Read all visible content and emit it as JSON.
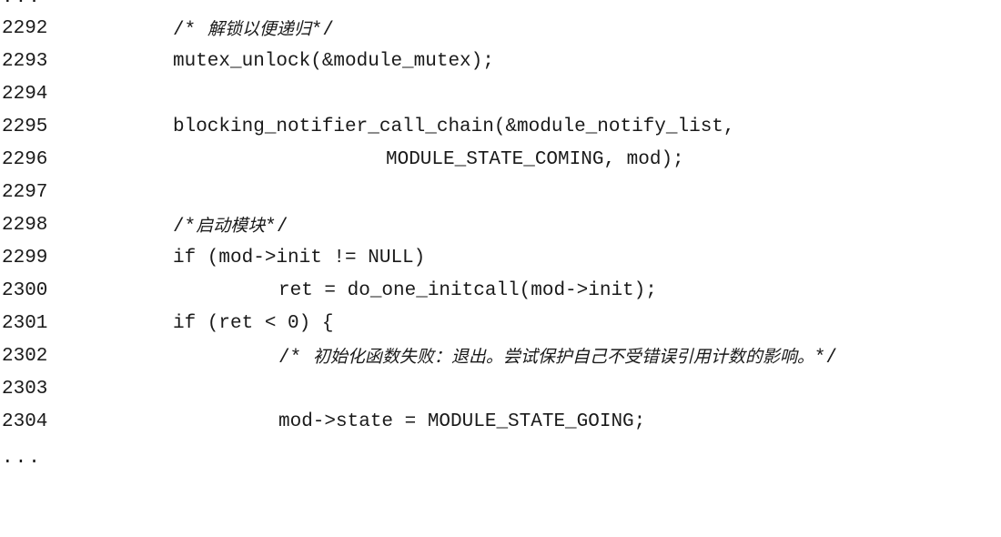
{
  "ellipsis_top": "...",
  "ellipsis_bottom": "...",
  "lines": [
    {
      "num": "2292",
      "pre": "/* ",
      "cjk": "解锁以便递归",
      "post": "*/"
    },
    {
      "num": "2293",
      "code": "mutex_unlock(&module_mutex);"
    },
    {
      "num": "2294",
      "code": ""
    },
    {
      "num": "2295",
      "code": "blocking_notifier_call_chain(&module_notify_list,"
    },
    {
      "num": "2296",
      "code": "MODULE_STATE_COMING, mod);"
    },
    {
      "num": "2297",
      "code": ""
    },
    {
      "num": "2298",
      "pre": "/*",
      "cjk": "启动模块",
      "post": "*/"
    },
    {
      "num": "2299",
      "code": "if (mod->init != NULL)"
    },
    {
      "num": "2300",
      "code": "ret = do_one_initcall(mod->init);"
    },
    {
      "num": "2301",
      "code": "if (ret < 0) {"
    },
    {
      "num": "2302",
      "pre": "/* ",
      "cjk": "初始化函数失败：退出。尝试保护自己不受错误引用计数的影响。",
      "post": "*/"
    },
    {
      "num": "2303",
      "code": ""
    },
    {
      "num": "2304",
      "code": "mod->state = MODULE_STATE_GOING;"
    }
  ]
}
